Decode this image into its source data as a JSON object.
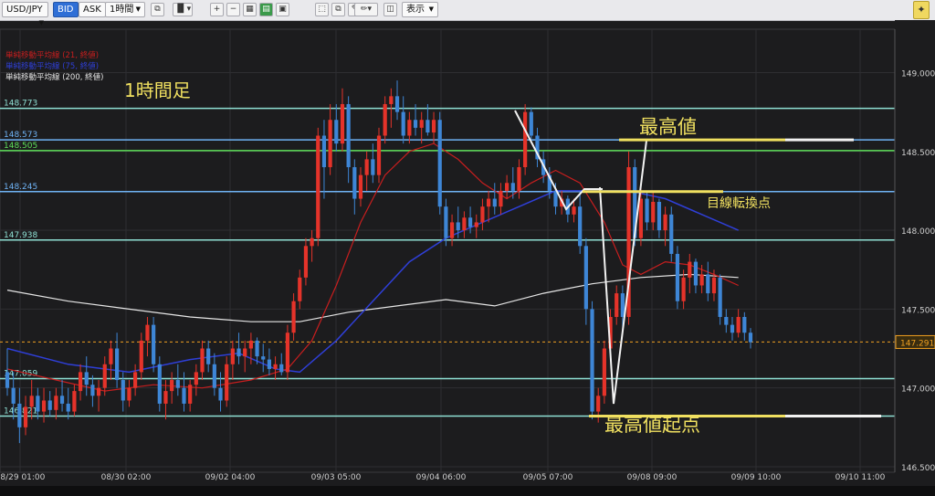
{
  "toolbar": {
    "symbol": "USD/JPY",
    "bid_label": "BID",
    "ask_label": "ASK",
    "timeframe": "1時間",
    "display_label": "表示"
  },
  "legend": [
    {
      "text": "単純移動平均線 (21, 終値)",
      "color": "#c81e1e"
    },
    {
      "text": "単純移動平均線 (75, 終値)",
      "color": "#2f3fd8"
    },
    {
      "text": "単純移動平均線 (200, 終値)",
      "color": "#e6e6e6"
    }
  ],
  "chart_title": "1時間足",
  "chart_data": {
    "type": "candlestick",
    "symbol": "USD/JPY",
    "timeframe": "1時間足",
    "ylim": [
      146.465,
      149.275
    ],
    "ytick_labels": [
      "149.000",
      "148.500",
      "148.000",
      "147.500",
      "147.000",
      "146.500"
    ],
    "ytick_values": [
      149.0,
      148.5,
      148.0,
      147.5,
      147.0,
      146.5
    ],
    "xtick_labels": [
      "08/29 01:00",
      "08/30 02:00",
      "09/02 04:00",
      "09/03 05:00",
      "09/04 06:00",
      "09/05 07:00",
      "09/08 09:00",
      "09/09 10:00",
      "09/10 11:00"
    ],
    "current_price": {
      "label": "147.291",
      "value": 147.291,
      "color": "#f0a020"
    },
    "horizontal_lines": [
      {
        "label": "148.773",
        "value": 148.773,
        "color": "#8fe0d4"
      },
      {
        "label": "148.573",
        "value": 148.573,
        "color": "#6fb3f5"
      },
      {
        "label": "148.505",
        "value": 148.505,
        "color": "#5ee05a"
      },
      {
        "label": "148.245",
        "value": 148.245,
        "color": "#6fb3f5"
      },
      {
        "label": "147.938",
        "value": 147.938,
        "color": "#8fe0d4"
      },
      {
        "label": "147.059",
        "value": 147.059,
        "color": "#8fe0d4"
      },
      {
        "label": "146.821",
        "value": 146.821,
        "color": "#8fe0d4"
      }
    ],
    "candles": [
      {
        "o": 147.1,
        "h": 147.25,
        "l": 146.95,
        "c": 147.0
      },
      {
        "o": 147.0,
        "h": 147.1,
        "l": 146.8,
        "c": 146.9
      },
      {
        "o": 146.9,
        "h": 147.0,
        "l": 146.65,
        "c": 146.75
      },
      {
        "o": 146.75,
        "h": 146.95,
        "l": 146.7,
        "c": 146.88
      },
      {
        "o": 146.88,
        "h": 147.05,
        "l": 146.8,
        "c": 146.95
      },
      {
        "o": 146.95,
        "h": 147.0,
        "l": 146.8,
        "c": 146.85
      },
      {
        "o": 146.85,
        "h": 147.0,
        "l": 146.78,
        "c": 146.92
      },
      {
        "o": 146.92,
        "h": 146.98,
        "l": 146.82,
        "c": 146.86
      },
      {
        "o": 146.86,
        "h": 147.0,
        "l": 146.8,
        "c": 146.95
      },
      {
        "o": 146.95,
        "h": 147.05,
        "l": 146.85,
        "c": 146.9
      },
      {
        "o": 146.9,
        "h": 147.0,
        "l": 146.8,
        "c": 146.85
      },
      {
        "o": 146.85,
        "h": 147.02,
        "l": 146.82,
        "c": 146.98
      },
      {
        "o": 146.98,
        "h": 147.15,
        "l": 146.92,
        "c": 147.1
      },
      {
        "o": 147.1,
        "h": 147.2,
        "l": 146.95,
        "c": 147.02
      },
      {
        "o": 147.02,
        "h": 147.08,
        "l": 146.88,
        "c": 146.95
      },
      {
        "o": 146.95,
        "h": 147.05,
        "l": 146.85,
        "c": 147.0
      },
      {
        "o": 147.0,
        "h": 147.2,
        "l": 146.95,
        "c": 147.15
      },
      {
        "o": 147.15,
        "h": 147.3,
        "l": 147.05,
        "c": 147.25
      },
      {
        "o": 147.25,
        "h": 147.35,
        "l": 147.0,
        "c": 147.05
      },
      {
        "o": 147.05,
        "h": 147.1,
        "l": 146.85,
        "c": 146.92
      },
      {
        "o": 146.92,
        "h": 147.05,
        "l": 146.88,
        "c": 147.0
      },
      {
        "o": 147.0,
        "h": 147.15,
        "l": 146.95,
        "c": 147.1
      },
      {
        "o": 147.1,
        "h": 147.35,
        "l": 147.05,
        "c": 147.3
      },
      {
        "o": 147.3,
        "h": 147.45,
        "l": 147.2,
        "c": 147.4
      },
      {
        "o": 147.4,
        "h": 147.45,
        "l": 147.1,
        "c": 147.15
      },
      {
        "o": 147.15,
        "h": 147.2,
        "l": 146.85,
        "c": 146.9
      },
      {
        "o": 146.9,
        "h": 147.05,
        "l": 146.8,
        "c": 146.98
      },
      {
        "o": 146.98,
        "h": 147.1,
        "l": 146.9,
        "c": 147.05
      },
      {
        "o": 147.05,
        "h": 147.15,
        "l": 146.95,
        "c": 147.0
      },
      {
        "o": 147.0,
        "h": 147.1,
        "l": 146.85,
        "c": 146.9
      },
      {
        "o": 146.9,
        "h": 147.05,
        "l": 146.85,
        "c": 147.02
      },
      {
        "o": 147.02,
        "h": 147.15,
        "l": 146.95,
        "c": 147.1
      },
      {
        "o": 147.1,
        "h": 147.3,
        "l": 147.05,
        "c": 147.25
      },
      {
        "o": 147.25,
        "h": 147.3,
        "l": 147.1,
        "c": 147.15
      },
      {
        "o": 147.15,
        "h": 147.22,
        "l": 146.95,
        "c": 147.0
      },
      {
        "o": 147.0,
        "h": 147.1,
        "l": 146.85,
        "c": 146.92
      },
      {
        "o": 146.92,
        "h": 147.2,
        "l": 146.88,
        "c": 147.15
      },
      {
        "o": 147.15,
        "h": 147.3,
        "l": 147.05,
        "c": 147.25
      },
      {
        "o": 147.25,
        "h": 147.35,
        "l": 147.15,
        "c": 147.2
      },
      {
        "o": 147.2,
        "h": 147.3,
        "l": 147.1,
        "c": 147.25
      },
      {
        "o": 147.25,
        "h": 147.35,
        "l": 147.15,
        "c": 147.3
      },
      {
        "o": 147.3,
        "h": 147.32,
        "l": 147.15,
        "c": 147.2
      },
      {
        "o": 147.2,
        "h": 147.28,
        "l": 147.1,
        "c": 147.18
      },
      {
        "o": 147.18,
        "h": 147.25,
        "l": 147.08,
        "c": 147.12
      },
      {
        "o": 147.12,
        "h": 147.2,
        "l": 147.05,
        "c": 147.15
      },
      {
        "o": 147.15,
        "h": 147.22,
        "l": 147.08,
        "c": 147.1
      },
      {
        "o": 147.1,
        "h": 147.4,
        "l": 147.05,
        "c": 147.35
      },
      {
        "o": 147.35,
        "h": 147.6,
        "l": 147.3,
        "c": 147.55
      },
      {
        "o": 147.55,
        "h": 147.75,
        "l": 147.5,
        "c": 147.7
      },
      {
        "o": 147.7,
        "h": 147.95,
        "l": 147.65,
        "c": 147.9
      },
      {
        "o": 147.9,
        "h": 148.0,
        "l": 147.8,
        "c": 147.95
      },
      {
        "o": 147.95,
        "h": 148.65,
        "l": 147.9,
        "c": 148.6
      },
      {
        "o": 148.6,
        "h": 148.7,
        "l": 148.2,
        "c": 148.4
      },
      {
        "o": 148.4,
        "h": 148.8,
        "l": 148.35,
        "c": 148.7
      },
      {
        "o": 148.7,
        "h": 148.8,
        "l": 148.5,
        "c": 148.55
      },
      {
        "o": 148.55,
        "h": 148.9,
        "l": 148.5,
        "c": 148.8
      },
      {
        "o": 148.8,
        "h": 148.85,
        "l": 148.3,
        "c": 148.4
      },
      {
        "o": 148.4,
        "h": 148.45,
        "l": 148.1,
        "c": 148.2
      },
      {
        "o": 148.2,
        "h": 148.4,
        "l": 148.15,
        "c": 148.35
      },
      {
        "o": 148.35,
        "h": 148.5,
        "l": 148.25,
        "c": 148.45
      },
      {
        "o": 148.45,
        "h": 148.55,
        "l": 148.3,
        "c": 148.35
      },
      {
        "o": 148.35,
        "h": 148.65,
        "l": 148.3,
        "c": 148.6
      },
      {
        "o": 148.6,
        "h": 148.85,
        "l": 148.55,
        "c": 148.8
      },
      {
        "o": 148.8,
        "h": 148.9,
        "l": 148.65,
        "c": 148.85
      },
      {
        "o": 148.85,
        "h": 148.95,
        "l": 148.7,
        "c": 148.75
      },
      {
        "o": 148.75,
        "h": 148.85,
        "l": 148.55,
        "c": 148.6
      },
      {
        "o": 148.6,
        "h": 148.75,
        "l": 148.55,
        "c": 148.7
      },
      {
        "o": 148.7,
        "h": 148.8,
        "l": 148.6,
        "c": 148.65
      },
      {
        "o": 148.65,
        "h": 148.75,
        "l": 148.55,
        "c": 148.7
      },
      {
        "o": 148.7,
        "h": 148.8,
        "l": 148.6,
        "c": 148.62
      },
      {
        "o": 148.62,
        "h": 148.75,
        "l": 148.55,
        "c": 148.7
      },
      {
        "o": 148.7,
        "h": 148.75,
        "l": 148.1,
        "c": 148.15
      },
      {
        "o": 148.15,
        "h": 148.2,
        "l": 147.9,
        "c": 147.95
      },
      {
        "o": 147.95,
        "h": 148.1,
        "l": 147.9,
        "c": 148.05
      },
      {
        "o": 148.05,
        "h": 148.15,
        "l": 147.95,
        "c": 148.0
      },
      {
        "o": 148.0,
        "h": 148.12,
        "l": 147.95,
        "c": 148.08
      },
      {
        "o": 148.08,
        "h": 148.15,
        "l": 147.98,
        "c": 148.02
      },
      {
        "o": 148.02,
        "h": 148.1,
        "l": 147.95,
        "c": 148.05
      },
      {
        "o": 148.05,
        "h": 148.2,
        "l": 148.0,
        "c": 148.15
      },
      {
        "o": 148.15,
        "h": 148.25,
        "l": 148.05,
        "c": 148.2
      },
      {
        "o": 148.2,
        "h": 148.3,
        "l": 148.1,
        "c": 148.15
      },
      {
        "o": 148.15,
        "h": 148.3,
        "l": 148.1,
        "c": 148.25
      },
      {
        "o": 148.25,
        "h": 148.35,
        "l": 148.2,
        "c": 148.3
      },
      {
        "o": 148.3,
        "h": 148.4,
        "l": 148.2,
        "c": 148.25
      },
      {
        "o": 148.25,
        "h": 148.45,
        "l": 148.2,
        "c": 148.4
      },
      {
        "o": 148.4,
        "h": 148.8,
        "l": 148.35,
        "c": 148.75
      },
      {
        "o": 148.75,
        "h": 148.78,
        "l": 148.55,
        "c": 148.6
      },
      {
        "o": 148.6,
        "h": 148.65,
        "l": 148.4,
        "c": 148.45
      },
      {
        "o": 148.45,
        "h": 148.5,
        "l": 148.3,
        "c": 148.35
      },
      {
        "o": 148.35,
        "h": 148.4,
        "l": 148.2,
        "c": 148.25
      },
      {
        "o": 148.25,
        "h": 148.3,
        "l": 148.1,
        "c": 148.15
      },
      {
        "o": 148.15,
        "h": 148.25,
        "l": 148.1,
        "c": 148.2
      },
      {
        "o": 148.2,
        "h": 148.22,
        "l": 148.05,
        "c": 148.1
      },
      {
        "o": 148.1,
        "h": 148.2,
        "l": 148.05,
        "c": 148.15
      },
      {
        "o": 148.15,
        "h": 148.25,
        "l": 147.85,
        "c": 147.9
      },
      {
        "o": 147.9,
        "h": 147.95,
        "l": 147.4,
        "c": 147.5
      },
      {
        "o": 147.5,
        "h": 147.55,
        "l": 146.8,
        "c": 146.85
      },
      {
        "o": 146.85,
        "h": 147.0,
        "l": 146.78,
        "c": 146.95
      },
      {
        "o": 146.95,
        "h": 147.3,
        "l": 146.9,
        "c": 147.25
      },
      {
        "o": 147.25,
        "h": 147.5,
        "l": 147.2,
        "c": 147.45
      },
      {
        "o": 147.45,
        "h": 147.65,
        "l": 147.4,
        "c": 147.6
      },
      {
        "o": 147.6,
        "h": 147.65,
        "l": 147.35,
        "c": 147.45
      },
      {
        "o": 147.45,
        "h": 148.5,
        "l": 147.4,
        "c": 148.4
      },
      {
        "o": 148.4,
        "h": 148.45,
        "l": 147.9,
        "c": 147.95
      },
      {
        "o": 147.95,
        "h": 148.3,
        "l": 147.9,
        "c": 148.2
      },
      {
        "o": 148.2,
        "h": 148.25,
        "l": 148.0,
        "c": 148.05
      },
      {
        "o": 148.05,
        "h": 148.25,
        "l": 148.0,
        "c": 148.18
      },
      {
        "o": 148.18,
        "h": 148.2,
        "l": 147.95,
        "c": 148.0
      },
      {
        "o": 148.0,
        "h": 148.15,
        "l": 147.9,
        "c": 148.1
      },
      {
        "o": 148.1,
        "h": 148.15,
        "l": 147.8,
        "c": 147.85
      },
      {
        "o": 147.85,
        "h": 147.9,
        "l": 147.5,
        "c": 147.55
      },
      {
        "o": 147.55,
        "h": 147.75,
        "l": 147.5,
        "c": 147.7
      },
      {
        "o": 147.7,
        "h": 147.85,
        "l": 147.6,
        "c": 147.8
      },
      {
        "o": 147.8,
        "h": 147.82,
        "l": 147.6,
        "c": 147.65
      },
      {
        "o": 147.65,
        "h": 147.78,
        "l": 147.6,
        "c": 147.72
      },
      {
        "o": 147.72,
        "h": 147.8,
        "l": 147.55,
        "c": 147.6
      },
      {
        "o": 147.6,
        "h": 147.75,
        "l": 147.55,
        "c": 147.7
      },
      {
        "o": 147.7,
        "h": 147.72,
        "l": 147.4,
        "c": 147.45
      },
      {
        "o": 147.45,
        "h": 147.5,
        "l": 147.35,
        "c": 147.4
      },
      {
        "o": 147.4,
        "h": 147.45,
        "l": 147.3,
        "c": 147.35
      },
      {
        "o": 147.35,
        "h": 147.5,
        "l": 147.32,
        "c": 147.45
      },
      {
        "o": 147.45,
        "h": 147.48,
        "l": 147.3,
        "c": 147.35
      },
      {
        "o": 147.35,
        "h": 147.38,
        "l": 147.25,
        "c": 147.29
      }
    ],
    "ma_21": [
      {
        "x": 0,
        "y": 147.12
      },
      {
        "x": 8,
        "y": 147.05
      },
      {
        "x": 16,
        "y": 146.98
      },
      {
        "x": 24,
        "y": 147.02
      },
      {
        "x": 32,
        "y": 147.0
      },
      {
        "x": 40,
        "y": 147.05
      },
      {
        "x": 46,
        "y": 147.12
      },
      {
        "x": 50,
        "y": 147.3
      },
      {
        "x": 54,
        "y": 147.65
      },
      {
        "x": 58,
        "y": 148.05
      },
      {
        "x": 62,
        "y": 148.35
      },
      {
        "x": 66,
        "y": 148.5
      },
      {
        "x": 70,
        "y": 148.55
      },
      {
        "x": 74,
        "y": 148.45
      },
      {
        "x": 78,
        "y": 148.3
      },
      {
        "x": 82,
        "y": 148.2
      },
      {
        "x": 86,
        "y": 148.3
      },
      {
        "x": 90,
        "y": 148.38
      },
      {
        "x": 94,
        "y": 148.3
      },
      {
        "x": 98,
        "y": 148.05
      },
      {
        "x": 101,
        "y": 147.78
      },
      {
        "x": 104,
        "y": 147.72
      },
      {
        "x": 108,
        "y": 147.8
      },
      {
        "x": 112,
        "y": 147.78
      },
      {
        "x": 116,
        "y": 147.72
      },
      {
        "x": 120,
        "y": 147.65
      }
    ],
    "ma_75": [
      {
        "x": 0,
        "y": 147.25
      },
      {
        "x": 10,
        "y": 147.15
      },
      {
        "x": 20,
        "y": 147.1
      },
      {
        "x": 30,
        "y": 147.18
      },
      {
        "x": 38,
        "y": 147.22
      },
      {
        "x": 44,
        "y": 147.12
      },
      {
        "x": 48,
        "y": 147.1
      },
      {
        "x": 54,
        "y": 147.3
      },
      {
        "x": 60,
        "y": 147.55
      },
      {
        "x": 66,
        "y": 147.8
      },
      {
        "x": 72,
        "y": 147.95
      },
      {
        "x": 78,
        "y": 148.05
      },
      {
        "x": 84,
        "y": 148.15
      },
      {
        "x": 90,
        "y": 148.25
      },
      {
        "x": 96,
        "y": 148.25
      },
      {
        "x": 102,
        "y": 148.25
      },
      {
        "x": 108,
        "y": 148.2
      },
      {
        "x": 114,
        "y": 148.1
      },
      {
        "x": 120,
        "y": 148.0
      }
    ],
    "ma_200": [
      {
        "x": 0,
        "y": 147.62
      },
      {
        "x": 10,
        "y": 147.55
      },
      {
        "x": 20,
        "y": 147.5
      },
      {
        "x": 30,
        "y": 147.45
      },
      {
        "x": 40,
        "y": 147.42
      },
      {
        "x": 48,
        "y": 147.42
      },
      {
        "x": 56,
        "y": 147.48
      },
      {
        "x": 64,
        "y": 147.52
      },
      {
        "x": 72,
        "y": 147.56
      },
      {
        "x": 80,
        "y": 147.52
      },
      {
        "x": 88,
        "y": 147.6
      },
      {
        "x": 96,
        "y": 147.66
      },
      {
        "x": 104,
        "y": 147.7
      },
      {
        "x": 112,
        "y": 147.72
      },
      {
        "x": 120,
        "y": 147.7
      }
    ]
  },
  "annotations": {
    "high_label": "最高値",
    "turning_label": "目線転換点",
    "origin_label": "最高値起点"
  },
  "colors": {
    "bull": "#e5332a",
    "bear": "#3e86d6",
    "ma21": "#c81e1e",
    "ma75": "#2f3fd8",
    "ma200": "#e6e6e6",
    "title": "#f0e060",
    "annotation_line": "#f0e060"
  }
}
